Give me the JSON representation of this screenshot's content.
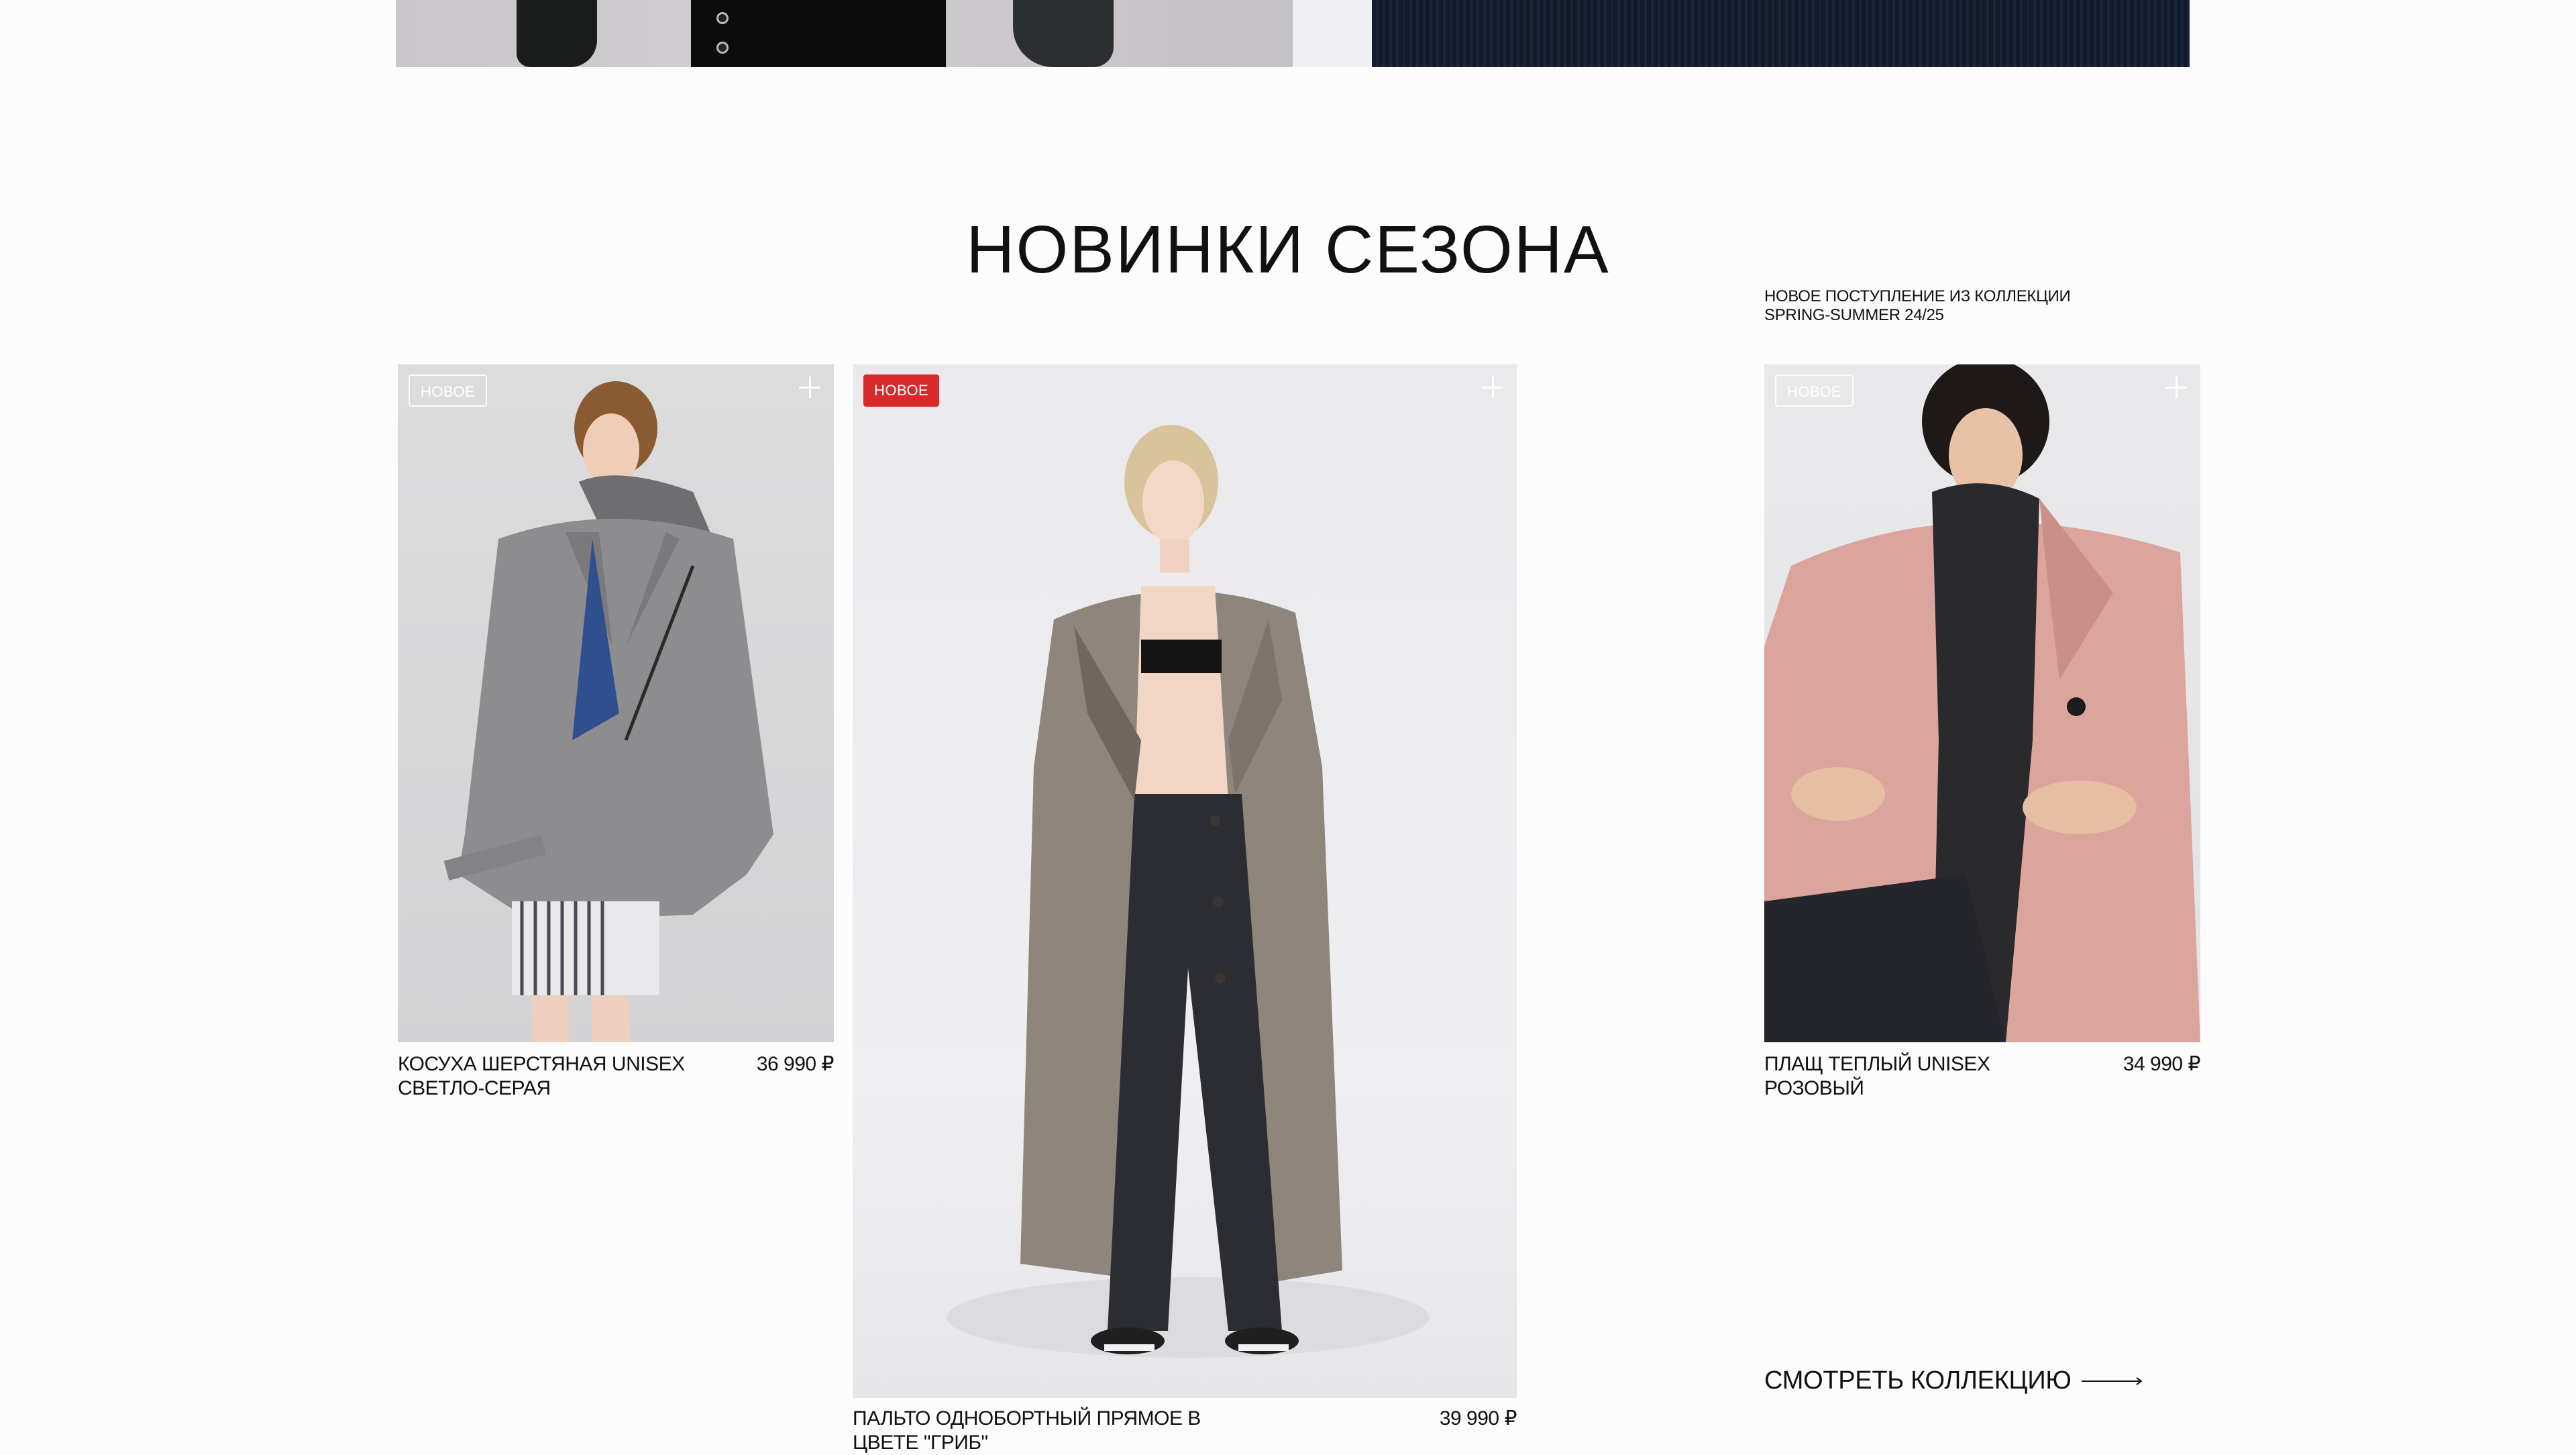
{
  "section": {
    "title": "НОВИНКИ СЕЗОНА",
    "collection_note": "НОВОЕ ПОСТУПЛЕНИЕ ИЗ КОЛЛЕКЦИИ SPRING-SUMMER 24/25"
  },
  "products": [
    {
      "badge": "НОВОЕ",
      "name": "КОСУХА ШЕРСТЯНАЯ UNISEX СВЕТЛО-СЕРАЯ",
      "price": "36 990 ₽"
    },
    {
      "badge": "НОВОЕ",
      "name": "ПАЛЬТО ОДНОБОРТНЫЙ ПРЯМОЕ В ЦВЕТЕ \"ГРИБ\"",
      "price": "39 990 ₽"
    },
    {
      "badge": "НОВОЕ",
      "name": "ПЛАЩ ТЕПЛЫЙ UNISEX РОЗОВЫЙ",
      "price": "34 990 ₽"
    }
  ],
  "cta": {
    "view_collection": "СМОТРЕТЬ КОЛЛЕКЦИЮ",
    "arrow_icon": "arrow-right-icon"
  },
  "colors": {
    "badge_accent": "#d9292b",
    "background": "#fcfcfd",
    "text": "#111111"
  }
}
